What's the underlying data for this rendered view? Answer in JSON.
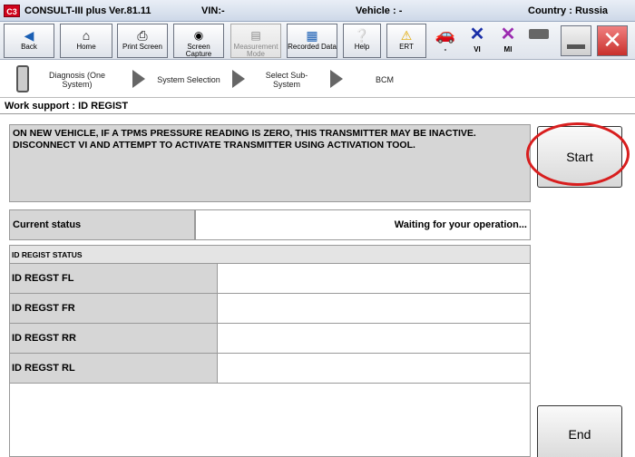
{
  "titlebar": {
    "app_name": "CONSULT-III plus",
    "version": "Ver.81.11",
    "vin_label": "VIN:-",
    "vehicle_label": "Vehicle : -",
    "country_label": "Country : Russia"
  },
  "toolbar": {
    "back": "Back",
    "home": "Home",
    "print_screen": "Print Screen",
    "screen_capture": "Screen Capture",
    "measurement_mode": "Measurement Mode",
    "recorded_data": "Recorded Data",
    "help": "Help",
    "ert": "ERT",
    "car_label": "-",
    "vi_label": "VI",
    "mi_label": "MI"
  },
  "breadcrumbs": {
    "diagnosis": "Diagnosis (One System)",
    "system_selection": "System Selection",
    "select_subsystem": "Select Sub-System",
    "bcm": "BCM"
  },
  "work_support": "Work support : ID REGIST",
  "message": "ON NEW VEHICLE, IF A TPMS PRESSURE READING IS ZERO, THIS TRANSMITTER MAY BE INACTIVE. DISCONNECT VI AND ATTEMPT TO ACTIVATE TRANSMITTER USING ACTIVATION TOOL.",
  "status": {
    "label": "Current status",
    "value": "Waiting for your operation..."
  },
  "id_regist": {
    "title": "ID REGIST STATUS",
    "rows": [
      {
        "label": "ID REGST FL",
        "value": ""
      },
      {
        "label": "ID REGST FR",
        "value": ""
      },
      {
        "label": "ID REGST RR",
        "value": ""
      },
      {
        "label": "ID REGST RL",
        "value": ""
      }
    ]
  },
  "buttons": {
    "start": "Start",
    "end": "End"
  },
  "colors": {
    "highlight_ring": "#d81e1e",
    "vi_x": "#1a2fa8",
    "mi_x": "#9b2bb0",
    "close_red": "#d9534f"
  }
}
